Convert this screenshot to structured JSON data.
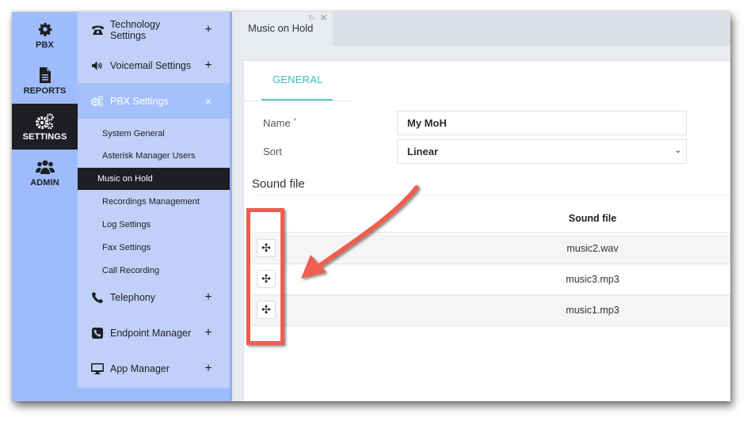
{
  "rail": {
    "items": [
      {
        "label": "PBX",
        "icon": "gear-icon",
        "active": false
      },
      {
        "label": "REPORTS",
        "icon": "document-icon",
        "active": false
      },
      {
        "label": "SETTINGS",
        "icon": "gears-icon",
        "active": true
      },
      {
        "label": "ADMIN",
        "icon": "users-icon",
        "active": false
      }
    ]
  },
  "menu": {
    "groups": [
      {
        "label": "Technology Settings",
        "icon": "phone-icon",
        "toggle": "+"
      },
      {
        "label": "Voicemail Settings",
        "icon": "volume-icon",
        "toggle": "+"
      },
      {
        "label": "PBX Settings",
        "icon": "gears-icon",
        "toggle": "×",
        "open": true
      },
      {
        "label": "Telephony",
        "icon": "phone-handset-icon",
        "toggle": "+"
      },
      {
        "label": "Endpoint Manager",
        "icon": "phone-square-icon",
        "toggle": "+"
      },
      {
        "label": "App Manager",
        "icon": "desktop-icon",
        "toggle": "+"
      }
    ],
    "pbx_settings_items": [
      {
        "label": "System General"
      },
      {
        "label": "Asterisk Manager Users"
      },
      {
        "label": "Music on Hold",
        "active": true
      },
      {
        "label": "Recordings Management"
      },
      {
        "label": "Log Settings"
      },
      {
        "label": "Fax Settings"
      },
      {
        "label": "Call Recording"
      }
    ]
  },
  "tabbar": {
    "tab_label": "Music on Hold",
    "reload_icon": "↻",
    "close_icon": "✕"
  },
  "form": {
    "tab_general": "GENERAL",
    "name_label": "Name",
    "required_mark": "*",
    "name_value": "My MoH",
    "sort_label": "Sort",
    "sort_value": "Linear",
    "sort_chevron": "⌄"
  },
  "sound_files": {
    "section_title": "Sound file",
    "column_header": "Sound file",
    "drag_icon": "✣",
    "rows": [
      {
        "file": "music2.wav"
      },
      {
        "file": "music3.mp3"
      },
      {
        "file": "music1.mp3"
      }
    ]
  },
  "colors": {
    "accent_teal": "#3bbdb0",
    "sidebar_blue": "#9ebcfc",
    "submenu_blue": "#c0d0f8",
    "active_dark": "#1d1f22",
    "annotation_red": "#ef5e4f"
  }
}
